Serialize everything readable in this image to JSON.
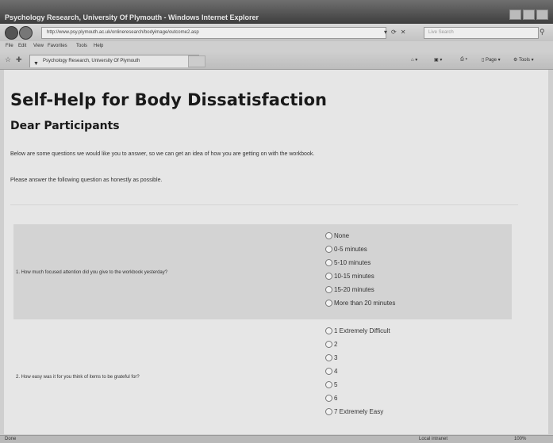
{
  "window": {
    "title": "Psychology Research, University Of Plymouth - Windows Internet Explorer"
  },
  "address_bar": {
    "url": "http://www.psy.plymouth.ac.uk/onlineresearch/bodyimage/outcome2.asp",
    "search_placeholder": "Live Search"
  },
  "menu": [
    "File",
    "Edit",
    "View",
    "Favorites",
    "Tools",
    "Help"
  ],
  "tab": {
    "label": "Psychology Research, University Of Plymouth"
  },
  "command_bar": {
    "page_label": "Page",
    "tools_label": "Tools"
  },
  "page": {
    "heading": "Self-Help for Body Dissatisfaction",
    "subheading": "Dear Participants",
    "intro": "Below are some questions we would like you to answer, so we can get an idea of how you are getting on with the workbook.",
    "instruction": "Please answer the following question as honestly as possible.",
    "questions": [
      {
        "text": "1. How much focused attention did you give to the workbook yesterday?",
        "options": [
          "None",
          "0-5 minutes",
          "5-10 minutes",
          "10-15 minutes",
          "15-20 minutes",
          "More than 20 minutes"
        ]
      },
      {
        "text": "2. How easy was it for you think of items to be grateful for?",
        "options": [
          "1 Extremely Difficult",
          "2",
          "3",
          "4",
          "5",
          "6",
          "7 Extremely Easy"
        ]
      }
    ]
  },
  "status_bar": {
    "left": "Done",
    "zone": "Local intranet",
    "zoom": "100%"
  }
}
